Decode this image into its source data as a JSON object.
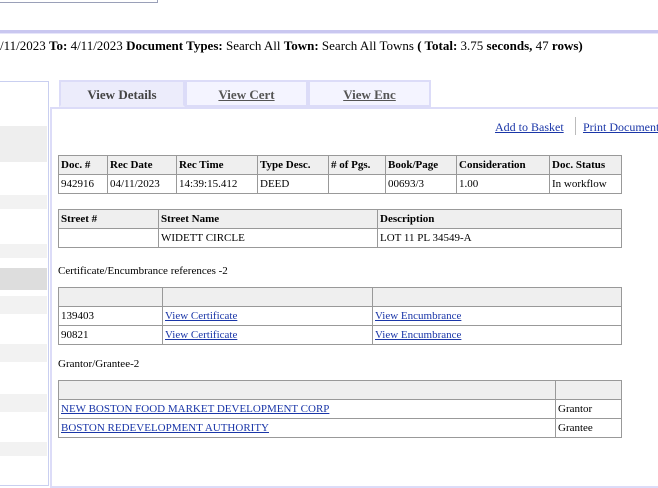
{
  "search": {
    "from_date_partial": "/11/2023",
    "to_label": "To:",
    "to_date": "4/11/2023",
    "doctype_label": "Document Types:",
    "doctype_value": "Search All",
    "town_label": "Town:",
    "town_value": "Search All Towns",
    "total_open": "( Total:",
    "seconds_value": "3.75",
    "seconds_label": "seconds,",
    "rows_value": "47",
    "rows_label": "rows)"
  },
  "tabs": [
    {
      "label": "View Details"
    },
    {
      "label": "View Cert"
    },
    {
      "label": "View Enc"
    }
  ],
  "actions": {
    "add_to_basket": "Add to Basket",
    "print_document": "Print Document"
  },
  "document": {
    "headers": [
      "Doc. #",
      "Rec Date",
      "Rec Time",
      "Type Desc.",
      "# of Pgs.",
      "Book/Page",
      "Consideration",
      "Doc. Status"
    ],
    "row": [
      "942916",
      "04/11/2023",
      "14:39:15.412",
      "DEED",
      "",
      "00693/3",
      "1.00",
      "In workflow"
    ]
  },
  "street": {
    "headers": [
      "Street #",
      "Street Name",
      "Description"
    ],
    "row": [
      "",
      "WIDETT CIRCLE",
      "LOT 11 PL 34549-A"
    ]
  },
  "cert_refs": {
    "label": "Certificate/Encumbrance references -2",
    "rows": [
      {
        "number": "139403",
        "cert_link": "View Certificate",
        "enc_link": "View Encumbrance"
      },
      {
        "number": "90821",
        "cert_link": "View Certificate",
        "enc_link": "View Encumbrance"
      }
    ]
  },
  "grantor": {
    "label": "Grantor/Grantee-2",
    "rows": [
      {
        "name": "NEW BOSTON FOOD MARKET DEVELOPMENT CORP",
        "role": "Grantor"
      },
      {
        "name": "BOSTON REDEVELOPMENT AUTHORITY",
        "role": "Grantee"
      }
    ]
  },
  "colors": {
    "link": "#1a36a8",
    "tab_border": "#dcdcf8",
    "top_rule": "#c9c7f0",
    "side_shade": "#eeeeee",
    "side_highlight": "#dddddd"
  }
}
